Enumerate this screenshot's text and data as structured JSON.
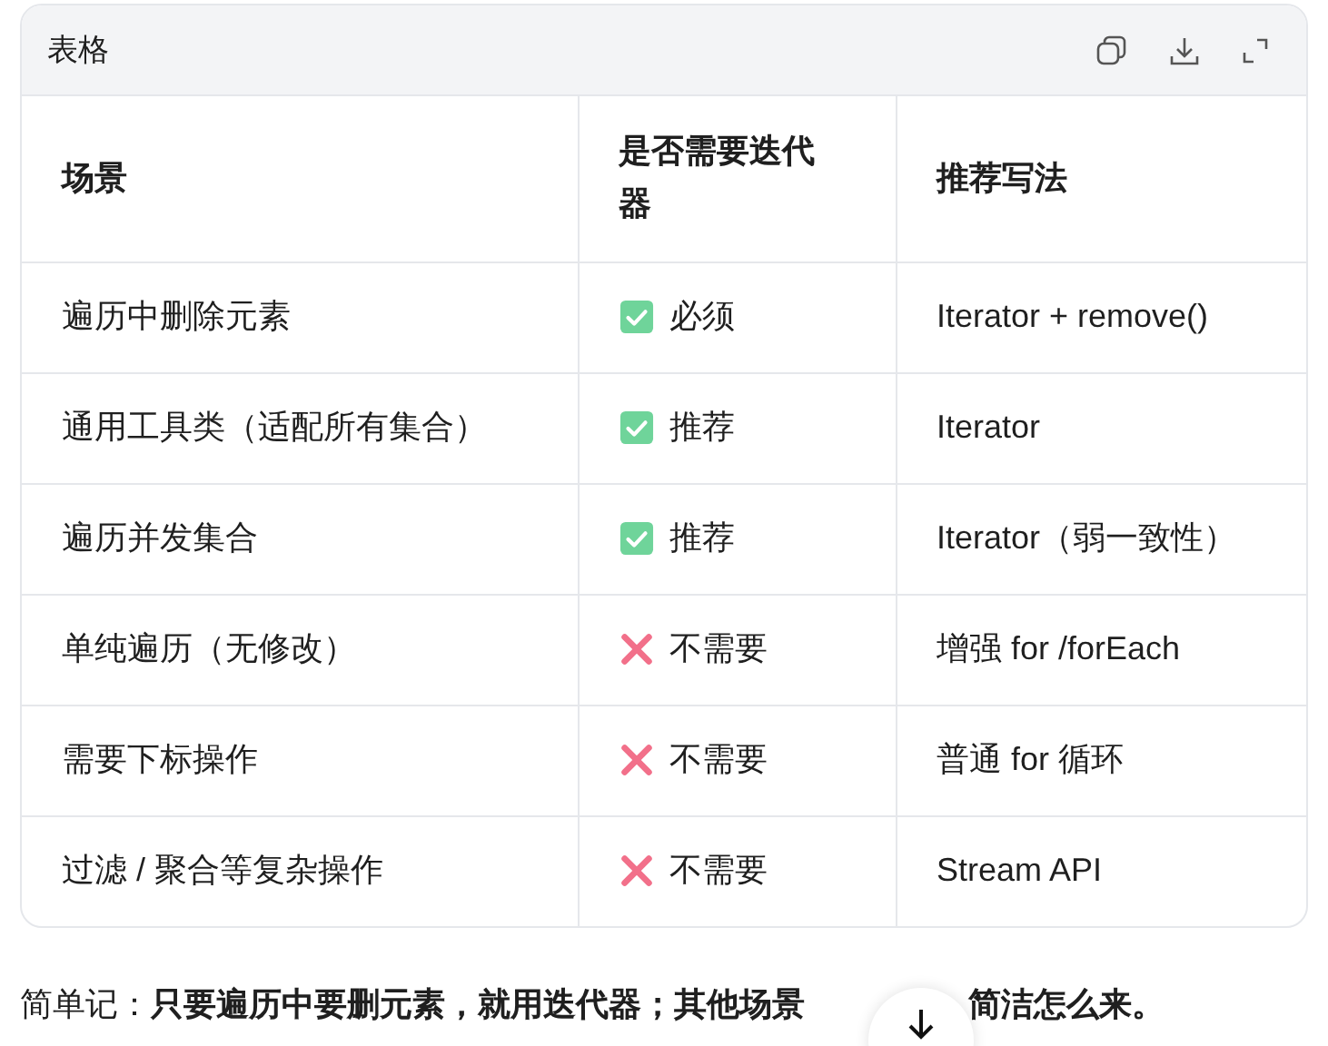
{
  "card": {
    "title": "表格"
  },
  "table": {
    "columns": [
      "场景",
      "是否需要迭代器",
      "推荐写法"
    ],
    "rows": [
      {
        "scene": "遍历中删除元素",
        "need": {
          "kind": "check",
          "label": "必须"
        },
        "usage": "Iterator + remove()"
      },
      {
        "scene": "通用工具类（适配所有集合）",
        "need": {
          "kind": "check",
          "label": "推荐"
        },
        "usage": "Iterator"
      },
      {
        "scene": "遍历并发集合",
        "need": {
          "kind": "check",
          "label": "推荐"
        },
        "usage": "Iterator（弱一致性）"
      },
      {
        "scene": "单纯遍历（无修改）",
        "need": {
          "kind": "cross",
          "label": "不需要"
        },
        "usage": "增强 for /forEach"
      },
      {
        "scene": "需要下标操作",
        "need": {
          "kind": "cross",
          "label": "不需要"
        },
        "usage": "普通 for 循环"
      },
      {
        "scene": "过滤 / 聚合等复杂操作",
        "need": {
          "kind": "cross",
          "label": "不需要"
        },
        "usage": "Stream API"
      }
    ]
  },
  "summary": {
    "before": "简单记：**只要遍历中要删元素，就用迭代器；其他场景**",
    "after": "简洁怎么来。"
  }
}
